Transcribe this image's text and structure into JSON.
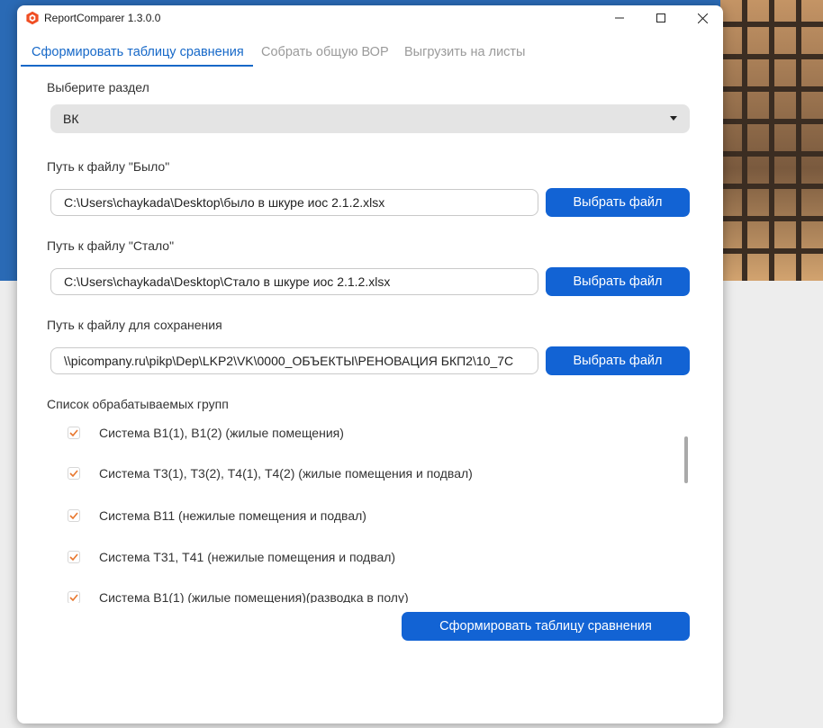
{
  "window": {
    "title": "ReportComparer 1.3.0.0",
    "accent": "#1263d4"
  },
  "tabs": [
    {
      "label": "Сформировать таблицу сравнения",
      "active": true
    },
    {
      "label": "Собрать общую ВОР",
      "active": false
    },
    {
      "label": "Выгрузить на листы",
      "active": false
    }
  ],
  "section": {
    "label": "Выберите раздел",
    "selected": "ВК"
  },
  "file_before": {
    "label": "Путь к файлу \"Было\"",
    "value": "C:\\Users\\chaykada\\Desktop\\было в шкуре иос 2.1.2.xlsx",
    "button": "Выбрать файл"
  },
  "file_after": {
    "label": "Путь к файлу \"Стало\"",
    "value": "C:\\Users\\chaykada\\Desktop\\Стало в шкуре иос 2.1.2.xlsx",
    "button": "Выбрать файл"
  },
  "file_save": {
    "label": "Путь к файлу для сохранения",
    "value": "\\\\picompany.ru\\pikp\\Dep\\LKP2\\VK\\0000_ОБЪЕКТЫ\\РЕНОВАЦИЯ БКП2\\10_7С",
    "button": "Выбрать файл"
  },
  "groups": {
    "label": "Список обрабатываемых групп",
    "items": [
      {
        "label": "Система В1(1), В1(2) (жилые помещения)",
        "checked": true
      },
      {
        "label": "Система Т3(1), Т3(2), Т4(1), Т4(2) (жилые помещения и подвал)",
        "checked": true
      },
      {
        "label": "Система В11 (нежилые помещения и подвал)",
        "checked": true
      },
      {
        "label": "Система Т31, Т41 (нежилые помещения и подвал)",
        "checked": true
      },
      {
        "label": "Система В1(1) (жилые помещения)(разводка в полу)",
        "checked": true
      }
    ]
  },
  "submit_label": "Сформировать таблицу сравнения"
}
